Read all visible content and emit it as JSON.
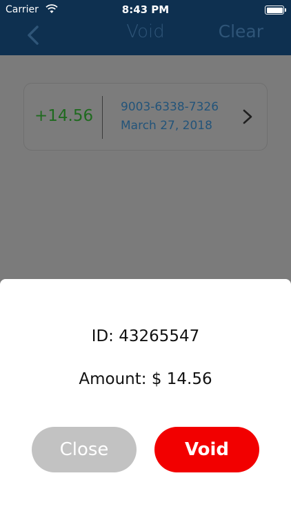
{
  "status_bar": {
    "carrier": "Carrier",
    "time": "8:43 PM"
  },
  "nav": {
    "back_icon": "chevron-left-icon",
    "title": "Void",
    "right_action": "Clear"
  },
  "transaction": {
    "amount": "+14.56",
    "card_number": "9003-6338-7326",
    "date": "March 27, 2018"
  },
  "modal": {
    "id_text": "ID: 43265547",
    "amount_text": "Amount: $ 14.56",
    "close_label": "Close",
    "void_label": "Void"
  },
  "colors": {
    "nav_background": "#0e3050",
    "void_button": "#f20000",
    "close_button": "#c2c2c2",
    "amount_positive": "#1f6a1f"
  }
}
